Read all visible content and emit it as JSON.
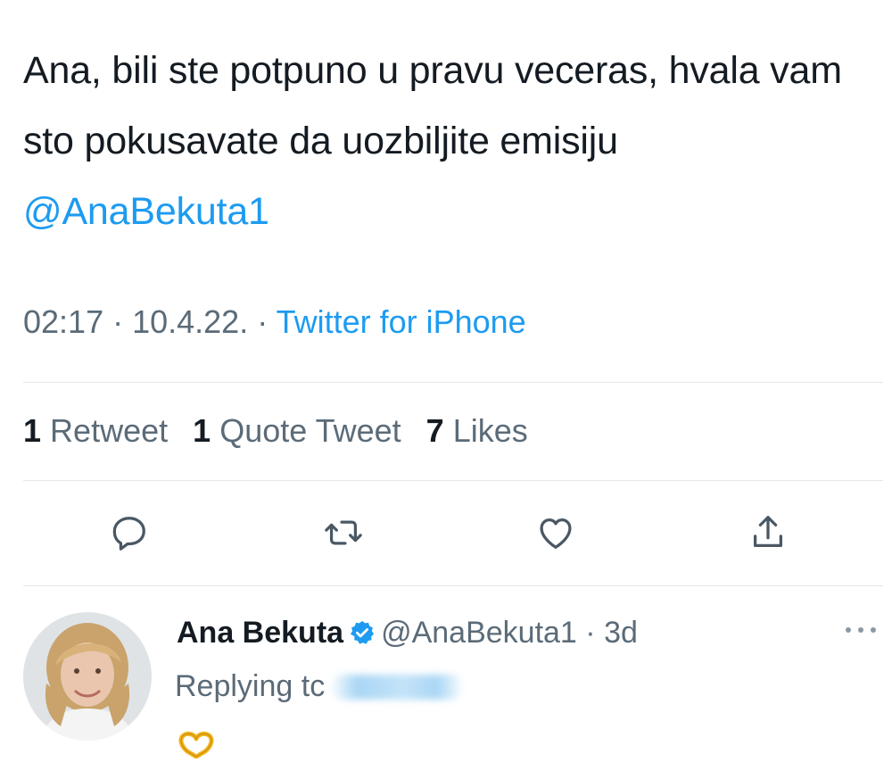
{
  "tweet": {
    "text": "Ana, bili ste potpuno u pravu veceras, hvala vam sto pokusavate da uozbiljite emisiju ",
    "mention": "@AnaBekuta1",
    "time": "02:17",
    "sep1": " · ",
    "date": "10.4.22.",
    "sep2": " · ",
    "source": "Twitter for iPhone"
  },
  "stats": {
    "retweets_count": "1",
    "retweets_label": "Retweet",
    "quotes_count": "1",
    "quotes_label": "Quote Tweet",
    "likes_count": "7",
    "likes_label": "Likes"
  },
  "actions": {
    "icons": [
      "reply-icon",
      "retweet-icon",
      "like-icon",
      "share-icon"
    ]
  },
  "reply": {
    "name": "Ana Bekuta",
    "handle": "@AnaBekuta1",
    "time_sep": " · ",
    "time": "3d",
    "replying_label": "Replying tc",
    "emoji": "heart-hands-emoji"
  },
  "colors": {
    "accent": "#1d9bf0",
    "secondary_text": "#5b6b78",
    "primary_text": "#141b22"
  }
}
